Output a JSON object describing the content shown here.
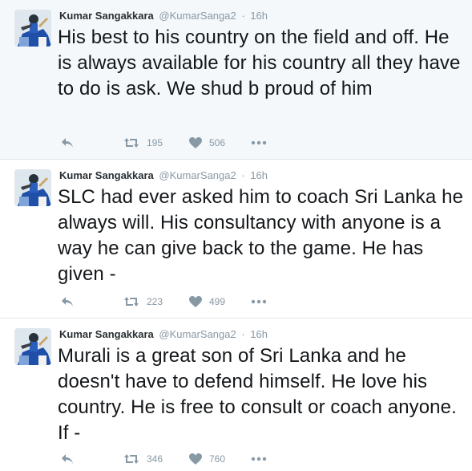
{
  "colors": {
    "name": "#292f33",
    "meta": "#8899a6",
    "text": "#14171a",
    "highlight_bg": "#f5f8fa"
  },
  "tweets": [
    {
      "name": "Kumar Sangakkara",
      "handle": "@KumarSanga2",
      "dot": "·",
      "time": "16h",
      "text": "His best to his country on the field and off. He is always available for his country all they have to do is ask. We shud b proud of him",
      "retweets": "195",
      "likes": "506",
      "icons": [
        "reply-icon",
        "retweet-icon",
        "heart-icon",
        "more-icon"
      ]
    },
    {
      "name": "Kumar Sangakkara",
      "handle": "@KumarSanga2",
      "dot": "·",
      "time": "16h",
      "text": "SLC had ever asked him to coach Sri Lanka he always will. His consultancy  with anyone is a way he can give back to the game. He has given -",
      "retweets": "223",
      "likes": "499",
      "icons": [
        "reply-icon",
        "retweet-icon",
        "heart-icon",
        "more-icon"
      ]
    },
    {
      "name": "Kumar Sangakkara",
      "handle": "@KumarSanga2",
      "dot": "·",
      "time": "16h",
      "text": "Murali is a great son of Sri Lanka and he doesn't have to defend himself. He love his country. He is free to consult or coach anyone. If -",
      "retweets": "346",
      "likes": "760",
      "icons": [
        "reply-icon",
        "retweet-icon",
        "heart-icon",
        "more-icon"
      ]
    }
  ]
}
